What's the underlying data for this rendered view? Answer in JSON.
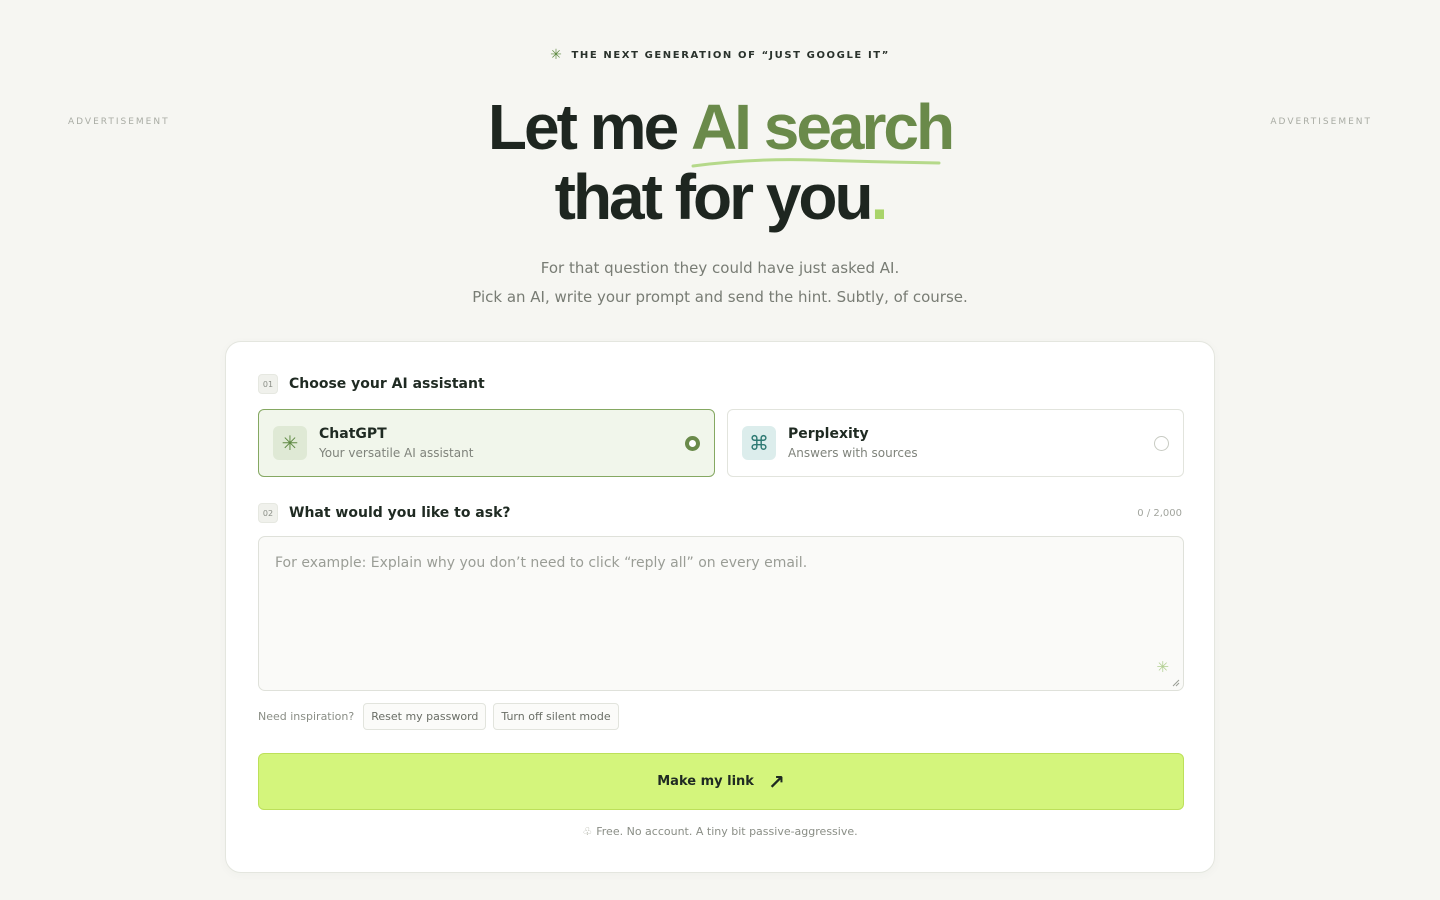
{
  "ads": {
    "left": "ADVERTISEMENT",
    "right": "ADVERTISEMENT"
  },
  "eyebrow": {
    "icon": "sparkle-icon",
    "text": "THE NEXT GENERATION OF “JUST GOOGLE IT”"
  },
  "hero": {
    "part1": "Let me ",
    "highlight": "AI search",
    "part2": "that for you",
    "dot": "."
  },
  "subtitle": {
    "line1": "For that question they could have just asked AI.",
    "line2": "Pick an AI, write your prompt and send the hint. Subtly, of course."
  },
  "step1": {
    "num": "01",
    "title": "Choose your AI assistant",
    "options": [
      {
        "name": "ChatGPT",
        "desc": "Your versatile AI assistant",
        "icon": "asterisk-icon",
        "selected": true
      },
      {
        "name": "Perplexity",
        "desc": "Answers with sources",
        "icon": "command-icon",
        "selected": false
      }
    ]
  },
  "step2": {
    "num": "02",
    "title": "What would you like to ask?",
    "counter": "0 / 2,000",
    "placeholder": "For example: Explain why you don’t need to click “reply all” on every email.",
    "value": ""
  },
  "inspiration": {
    "label": "Need inspiration?",
    "chips": [
      "Reset my password",
      "Turn off silent mode"
    ]
  },
  "cta": {
    "label": "Make my link",
    "icon": "arrow-up-right-icon"
  },
  "footnote": "Free. No account. A tiny bit passive-aggressive.",
  "colors": {
    "accent": "#6a8a4a",
    "cta": "#d4f57c",
    "background": "#f6f6f2"
  }
}
